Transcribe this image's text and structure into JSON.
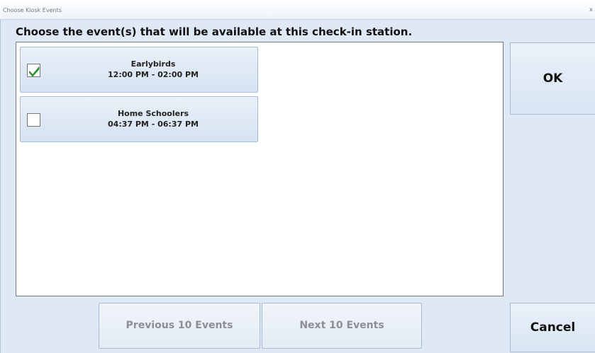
{
  "window": {
    "title": "Choose Kiosk Events",
    "close_glyph": "x"
  },
  "instruction": "Choose the event(s) that will be available at this check-in station.",
  "events": [
    {
      "name": "Earlybirds",
      "time": "12:00 PM - 02:00 PM",
      "checked": true
    },
    {
      "name": "Home Schoolers",
      "time": "04:37 PM - 06:37 PM",
      "checked": false
    }
  ],
  "buttons": {
    "ok": "OK",
    "cancel": "Cancel",
    "previous": "Previous 10 Events",
    "next": "Next 10 Events"
  },
  "colors": {
    "check_green": "#2e9e2e",
    "disabled_text": "#8b8f95"
  }
}
